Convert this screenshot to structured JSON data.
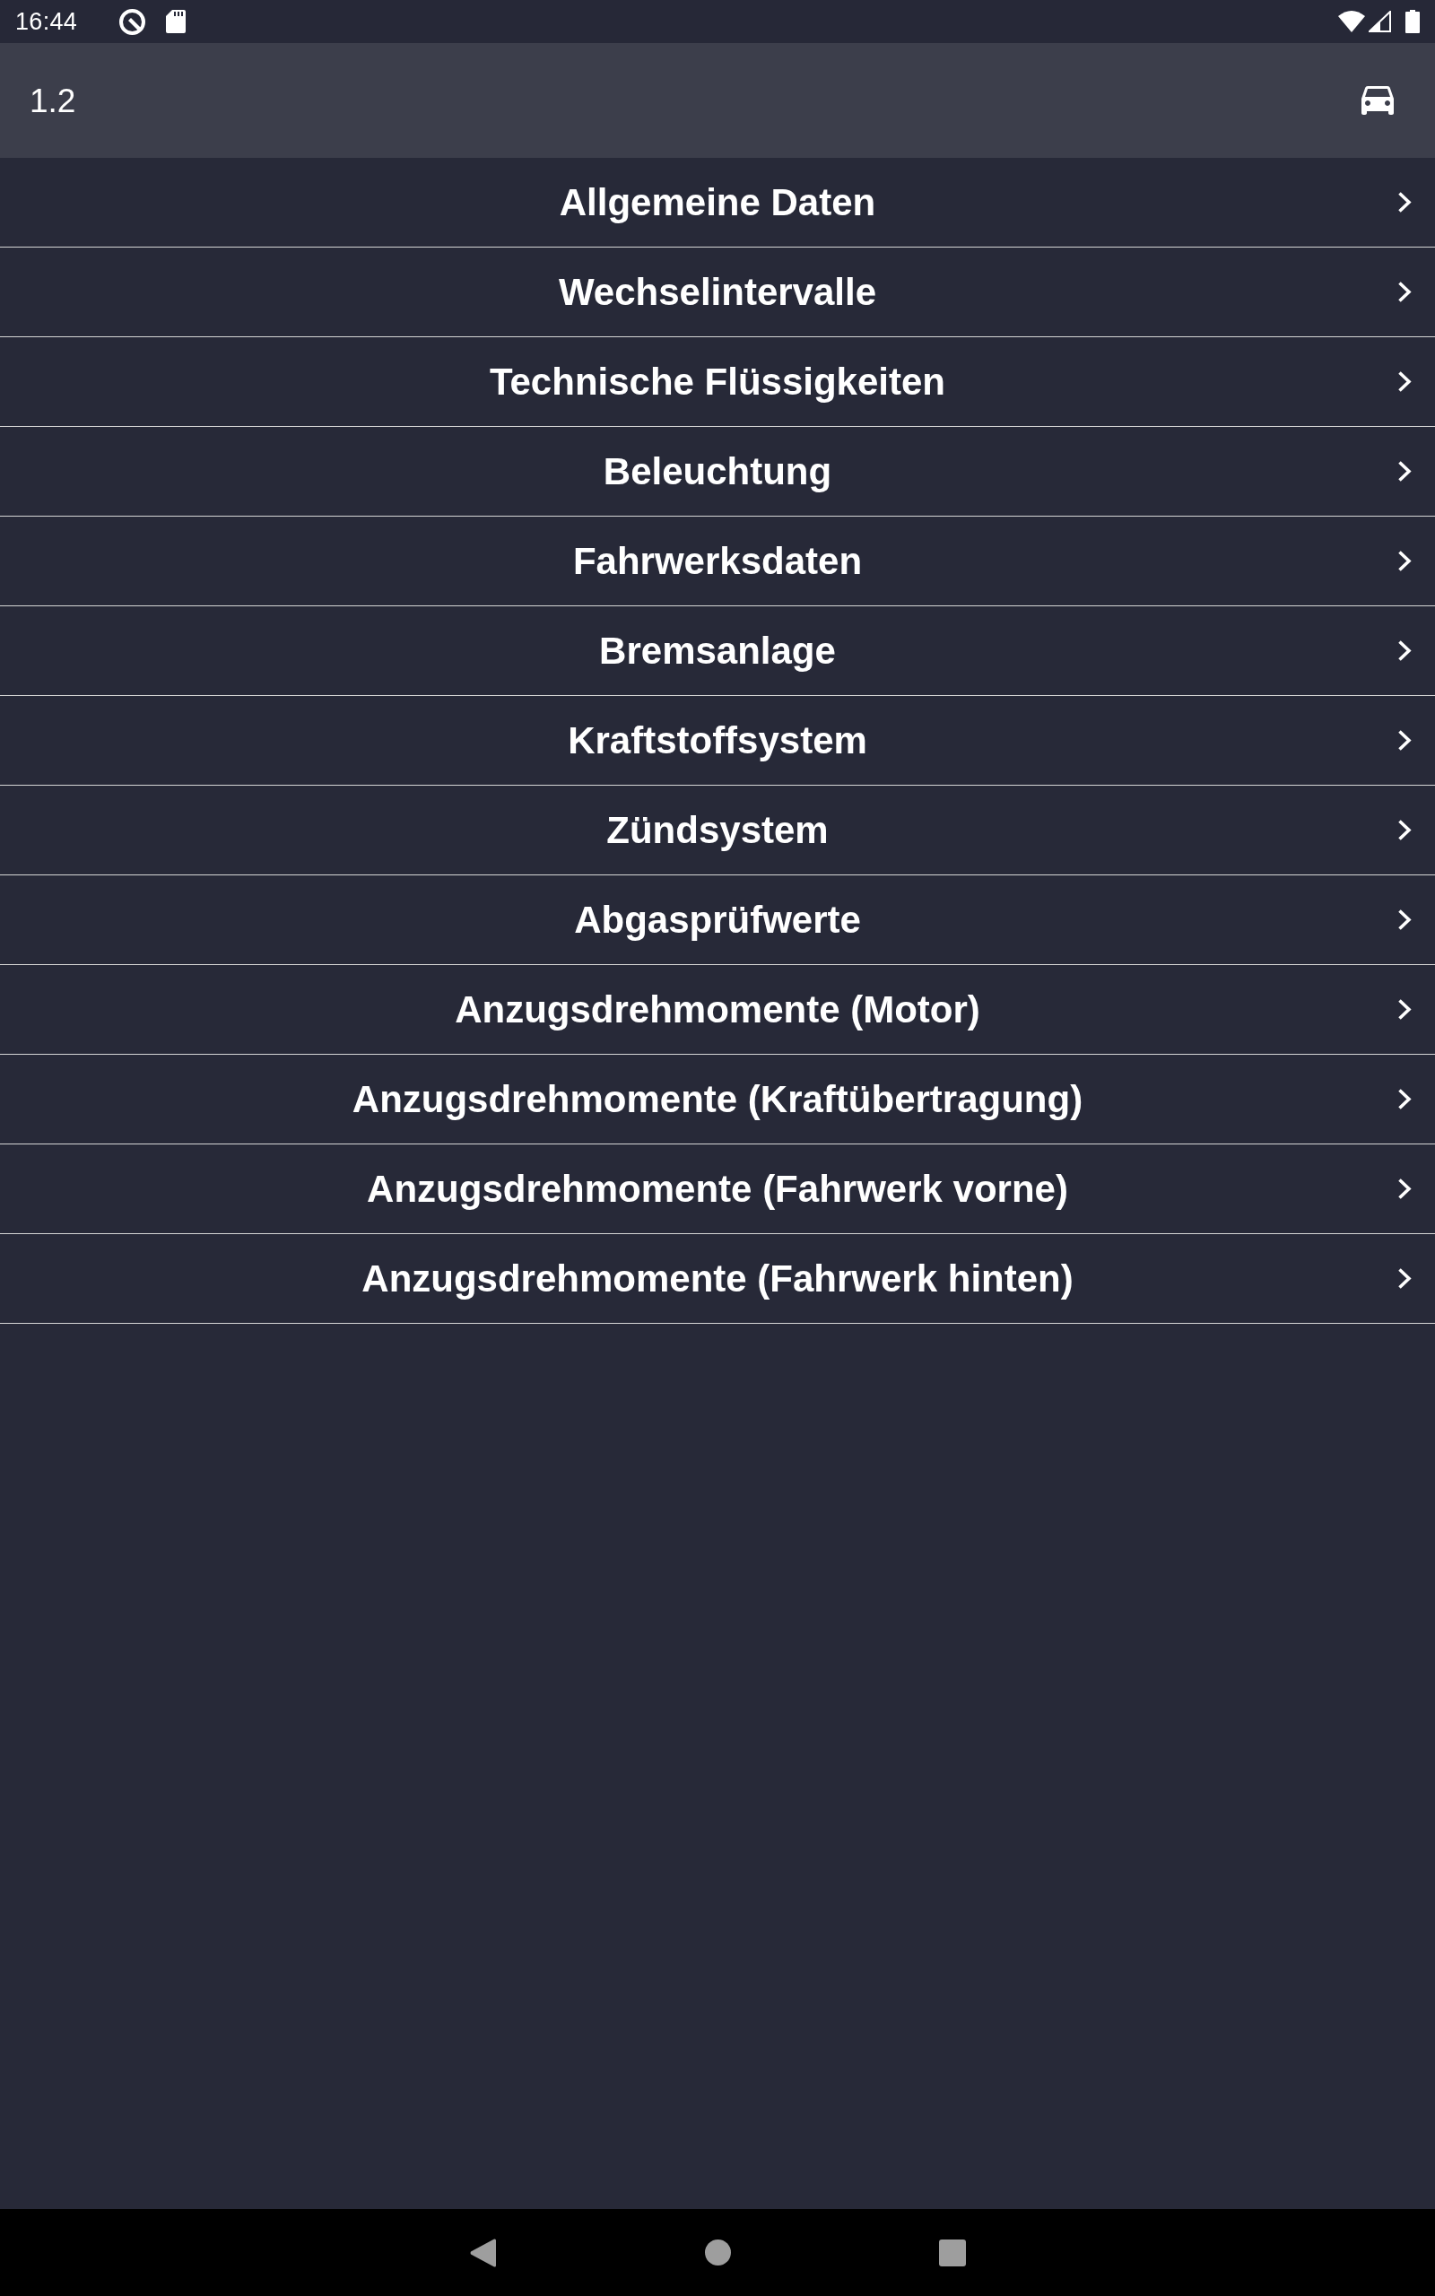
{
  "status_bar": {
    "time": "16:44"
  },
  "app_bar": {
    "title": "1.2"
  },
  "menu": [
    {
      "label": "Allgemeine Daten"
    },
    {
      "label": "Wechselintervalle"
    },
    {
      "label": "Technische Flüssigkeiten"
    },
    {
      "label": "Beleuchtung"
    },
    {
      "label": "Fahrwerksdaten"
    },
    {
      "label": "Bremsanlage"
    },
    {
      "label": "Kraftstoffsystem"
    },
    {
      "label": "Zündsystem"
    },
    {
      "label": "Abgasprüfwerte"
    },
    {
      "label": "Anzugsdrehmomente (Motor)"
    },
    {
      "label": "Anzugsdrehmomente (Kraftübertragung)"
    },
    {
      "label": "Anzugsdrehmomente (Fahrwerk vorne)"
    },
    {
      "label": "Anzugsdrehmomente (Fahrwerk hinten)"
    }
  ]
}
